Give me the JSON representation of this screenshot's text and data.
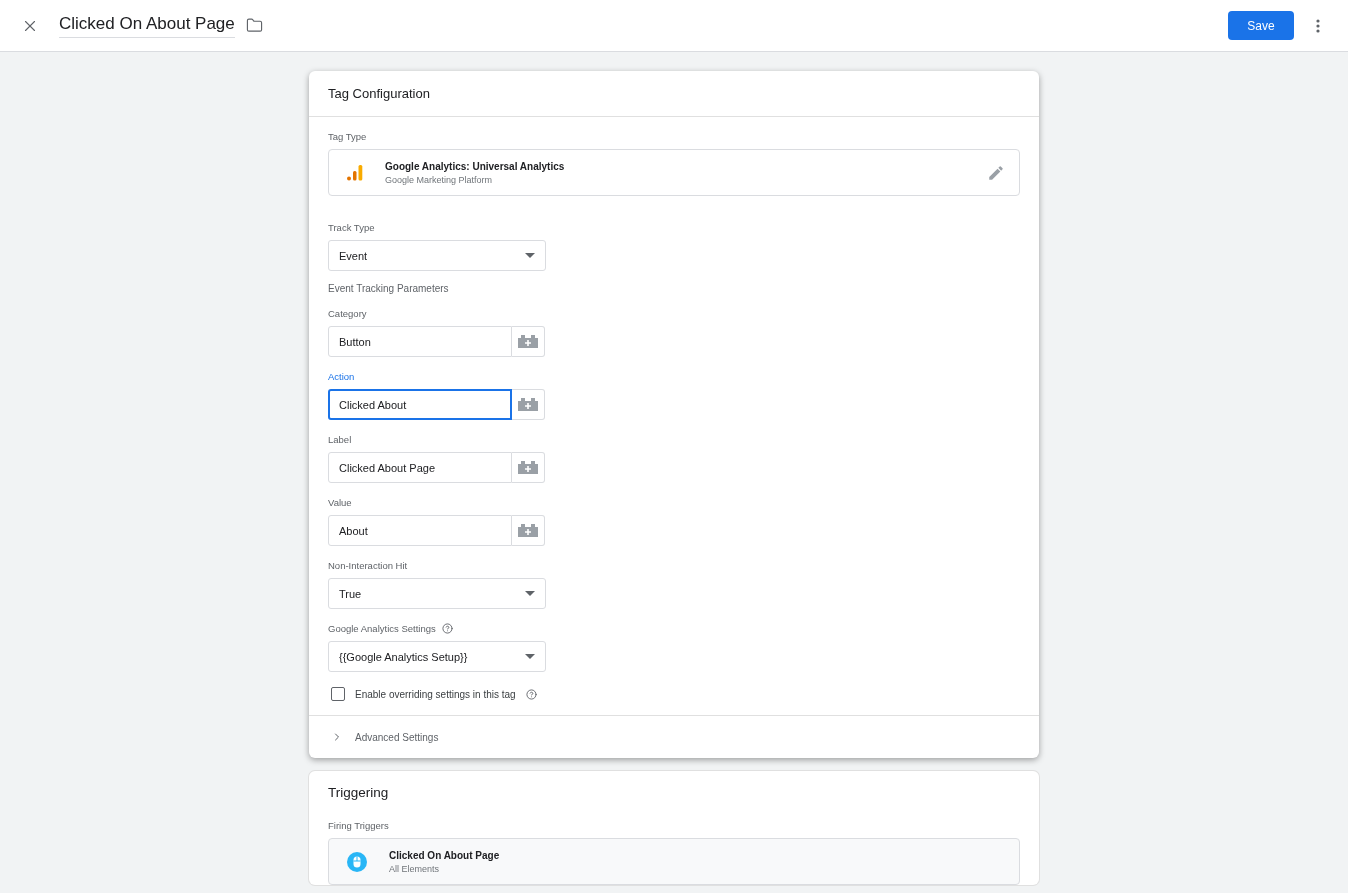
{
  "header": {
    "title": "Clicked On About Page",
    "save_label": "Save"
  },
  "tag_config": {
    "title": "Tag Configuration",
    "tag_type_label": "Tag Type",
    "tag_type": {
      "name": "Google Analytics: Universal Analytics",
      "provider": "Google Marketing Platform"
    },
    "fields": [
      {
        "kind": "select",
        "label": "Track Type",
        "value": "Event"
      },
      {
        "kind": "heading",
        "label": "Event Tracking Parameters"
      },
      {
        "kind": "variable_input",
        "label": "Category",
        "value": "Button",
        "focused": false
      },
      {
        "kind": "variable_input",
        "label": "Action",
        "value": "Clicked About",
        "focused": true
      },
      {
        "kind": "variable_input",
        "label": "Label",
        "value": "Clicked About Page",
        "focused": false
      },
      {
        "kind": "variable_input",
        "label": "Value",
        "value": "About",
        "focused": false
      },
      {
        "kind": "select",
        "label": "Non-Interaction Hit",
        "value": "True"
      },
      {
        "kind": "select",
        "label": "Google Analytics Settings",
        "value": "{{Google Analytics Setup}}",
        "help": true
      },
      {
        "kind": "checkbox",
        "label": "Enable overriding settings in this tag",
        "checked": false,
        "help": true
      }
    ],
    "advanced": {
      "label": "Advanced Settings",
      "expanded": false
    }
  },
  "triggering": {
    "title": "Triggering",
    "firing_label": "Firing Triggers",
    "triggers": [
      {
        "name": "Clicked On About Page",
        "type": "All Elements"
      }
    ]
  }
}
